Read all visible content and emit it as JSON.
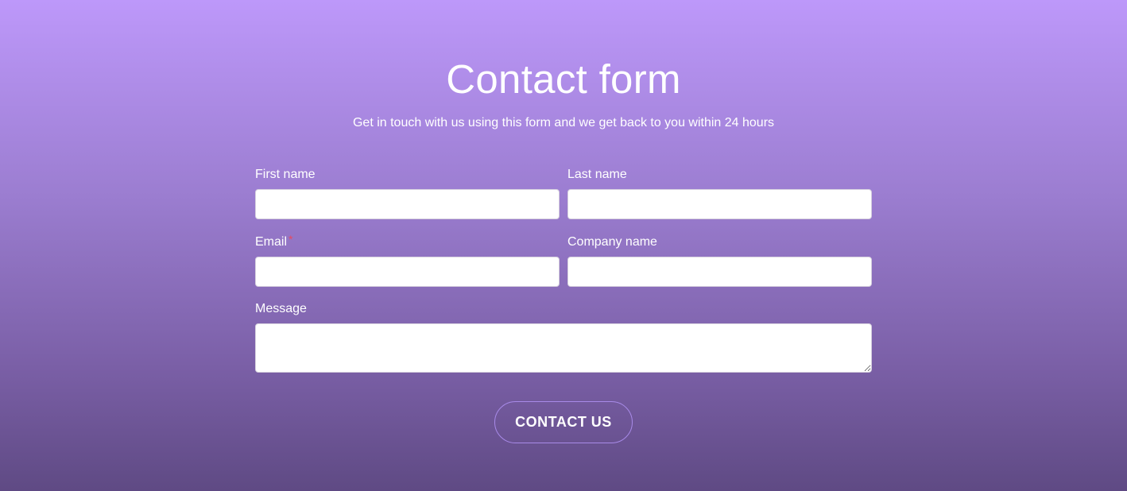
{
  "header": {
    "title": "Contact form",
    "subtitle": "Get in touch with us using this form and we get back to you within 24 hours"
  },
  "form": {
    "first_name": {
      "label": "First name",
      "value": "",
      "placeholder": ""
    },
    "last_name": {
      "label": "Last name",
      "value": "",
      "placeholder": ""
    },
    "email": {
      "label": "Email",
      "required_mark": "*",
      "value": "",
      "placeholder": ""
    },
    "company_name": {
      "label": "Company name",
      "value": "",
      "placeholder": ""
    },
    "message": {
      "label": "Message",
      "value": "",
      "placeholder": ""
    }
  },
  "submit": {
    "label": "CONTACT US"
  },
  "colors": {
    "gradient_top": "#bd98fa",
    "gradient_bottom": "#5f4a84",
    "required_mark": "#e84a5f",
    "button_border": "#a88ae8"
  }
}
